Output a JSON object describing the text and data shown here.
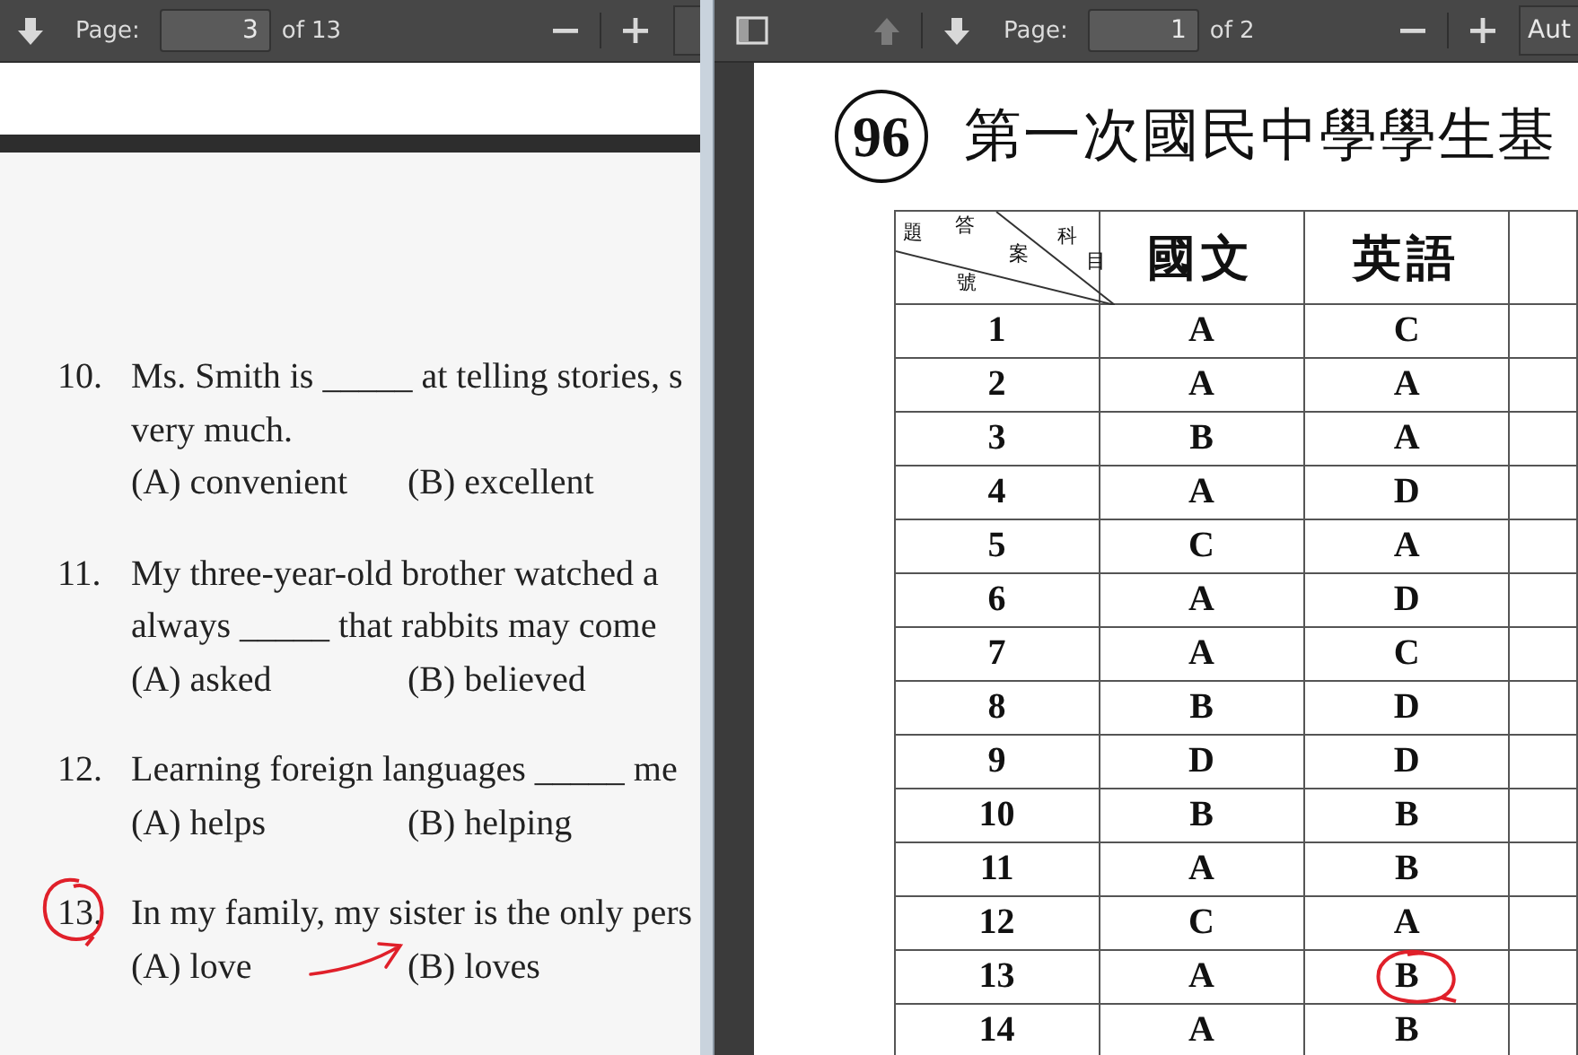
{
  "left_viewer": {
    "toolbar": {
      "page_label": "Page:",
      "page_value": "3",
      "page_count": "of 13"
    },
    "questions": [
      {
        "number": "10.",
        "number_circled": false,
        "lines": [
          "Ms. Smith is _____ at telling stories, s",
          "very much."
        ],
        "options": [
          {
            "text": "(A) convenient",
            "arrow": false
          },
          {
            "text": "(B) excellent",
            "arrow": false
          }
        ]
      },
      {
        "number": "11.",
        "number_circled": false,
        "lines": [
          "My three-year-old brother watched a",
          "always _____ that rabbits may come"
        ],
        "options": [
          {
            "text": "(A) asked",
            "arrow": false
          },
          {
            "text": "(B) believed",
            "arrow": false
          }
        ]
      },
      {
        "number": "12.",
        "number_circled": false,
        "lines": [
          "Learning foreign languages _____ me"
        ],
        "options": [
          {
            "text": "(A) helps",
            "arrow": false
          },
          {
            "text": "(B) helping",
            "arrow": false
          }
        ]
      },
      {
        "number": "13.",
        "number_circled": true,
        "lines": [
          "In my family, my sister is the only pers"
        ],
        "options": [
          {
            "text": "(A) love",
            "arrow": false
          },
          {
            "text": "(B) loves",
            "arrow": true
          }
        ]
      }
    ]
  },
  "right_viewer": {
    "toolbar": {
      "prev_disabled": true,
      "page_label": "Page:",
      "page_value": "1",
      "page_count": "of 2",
      "zoom_value": "Aut"
    },
    "document": {
      "title_badge": "96",
      "title": "第一次國民中學學生基",
      "table": {
        "corner_labels": [
          "答",
          "案",
          "科",
          "目",
          "題",
          "號"
        ],
        "columns": [
          "國文",
          "英語"
        ],
        "rows": [
          {
            "number": "1",
            "answers": [
              {
                "text": "A",
                "circled": false
              },
              {
                "text": "C",
                "circled": false
              }
            ]
          },
          {
            "number": "2",
            "answers": [
              {
                "text": "A",
                "circled": false
              },
              {
                "text": "A",
                "circled": false
              }
            ]
          },
          {
            "number": "3",
            "answers": [
              {
                "text": "B",
                "circled": false
              },
              {
                "text": "A",
                "circled": false
              }
            ]
          },
          {
            "number": "4",
            "answers": [
              {
                "text": "A",
                "circled": false
              },
              {
                "text": "D",
                "circled": false
              }
            ]
          },
          {
            "number": "5",
            "answers": [
              {
                "text": "C",
                "circled": false
              },
              {
                "text": "A",
                "circled": false
              }
            ]
          },
          {
            "number": "6",
            "answers": [
              {
                "text": "A",
                "circled": false
              },
              {
                "text": "D",
                "circled": false
              }
            ]
          },
          {
            "number": "7",
            "answers": [
              {
                "text": "A",
                "circled": false
              },
              {
                "text": "C",
                "circled": false
              }
            ]
          },
          {
            "number": "8",
            "answers": [
              {
                "text": "B",
                "circled": false
              },
              {
                "text": "D",
                "circled": false
              }
            ]
          },
          {
            "number": "9",
            "answers": [
              {
                "text": "D",
                "circled": false
              },
              {
                "text": "D",
                "circled": false
              }
            ]
          },
          {
            "number": "10",
            "answers": [
              {
                "text": "B",
                "circled": false
              },
              {
                "text": "B",
                "circled": false
              }
            ]
          },
          {
            "number": "11",
            "answers": [
              {
                "text": "A",
                "circled": false
              },
              {
                "text": "B",
                "circled": false
              }
            ]
          },
          {
            "number": "12",
            "answers": [
              {
                "text": "C",
                "circled": false
              },
              {
                "text": "A",
                "circled": false
              }
            ]
          },
          {
            "number": "13",
            "answers": [
              {
                "text": "A",
                "circled": false
              },
              {
                "text": "B",
                "circled": true
              }
            ]
          },
          {
            "number": "14",
            "answers": [
              {
                "text": "A",
                "circled": false
              },
              {
                "text": "B",
                "circled": false
              }
            ]
          }
        ]
      }
    }
  }
}
